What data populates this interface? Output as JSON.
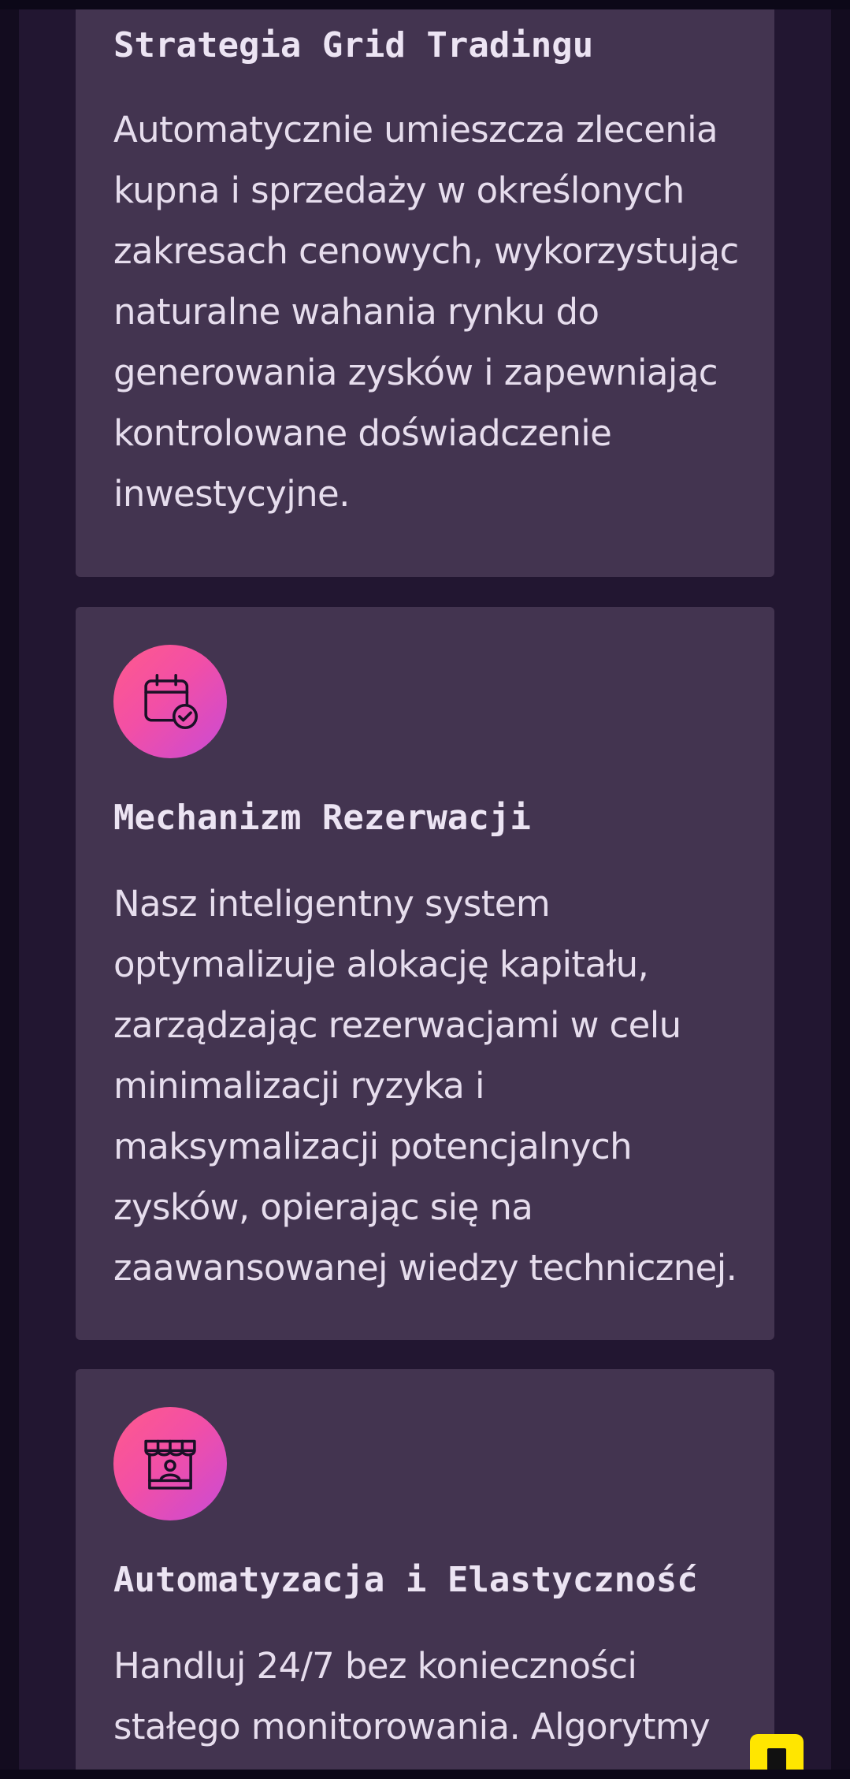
{
  "features": [
    {
      "title": "Strategia Grid Tradingu",
      "description": "Automatycznie umieszcza zlecenia kupna i sprzedaży w określonych zakresach cenowych, wykorzystując naturalne wahania rynku do generowania zysków i zapewniając kontrolowane doświadczenie inwestycyjne."
    },
    {
      "icon": "calendar-check-icon",
      "title": "Mechanizm Rezerwacji",
      "description": "Nasz inteligentny system optymalizuje alokację kapitału, zarządzając rezerwacjami w celu minimalizacji ryzyka i maksymalizacji potencjalnych zysków, opierając się na zaawansowanej wiedzy technicznej."
    },
    {
      "icon": "kiosk-icon",
      "title": "Automatyzacja i Elastyczność",
      "description": "Handluj 24/7 bez konieczności stałego monitorowania. Algorytmy"
    }
  ],
  "colors": {
    "page_background": "#221631",
    "card_background": "#433450",
    "icon_gradient_start": "#ff5a8c",
    "icon_gradient_end": "#c94ad6",
    "text": "#e6dded",
    "floating_badge": "#ffe600"
  }
}
